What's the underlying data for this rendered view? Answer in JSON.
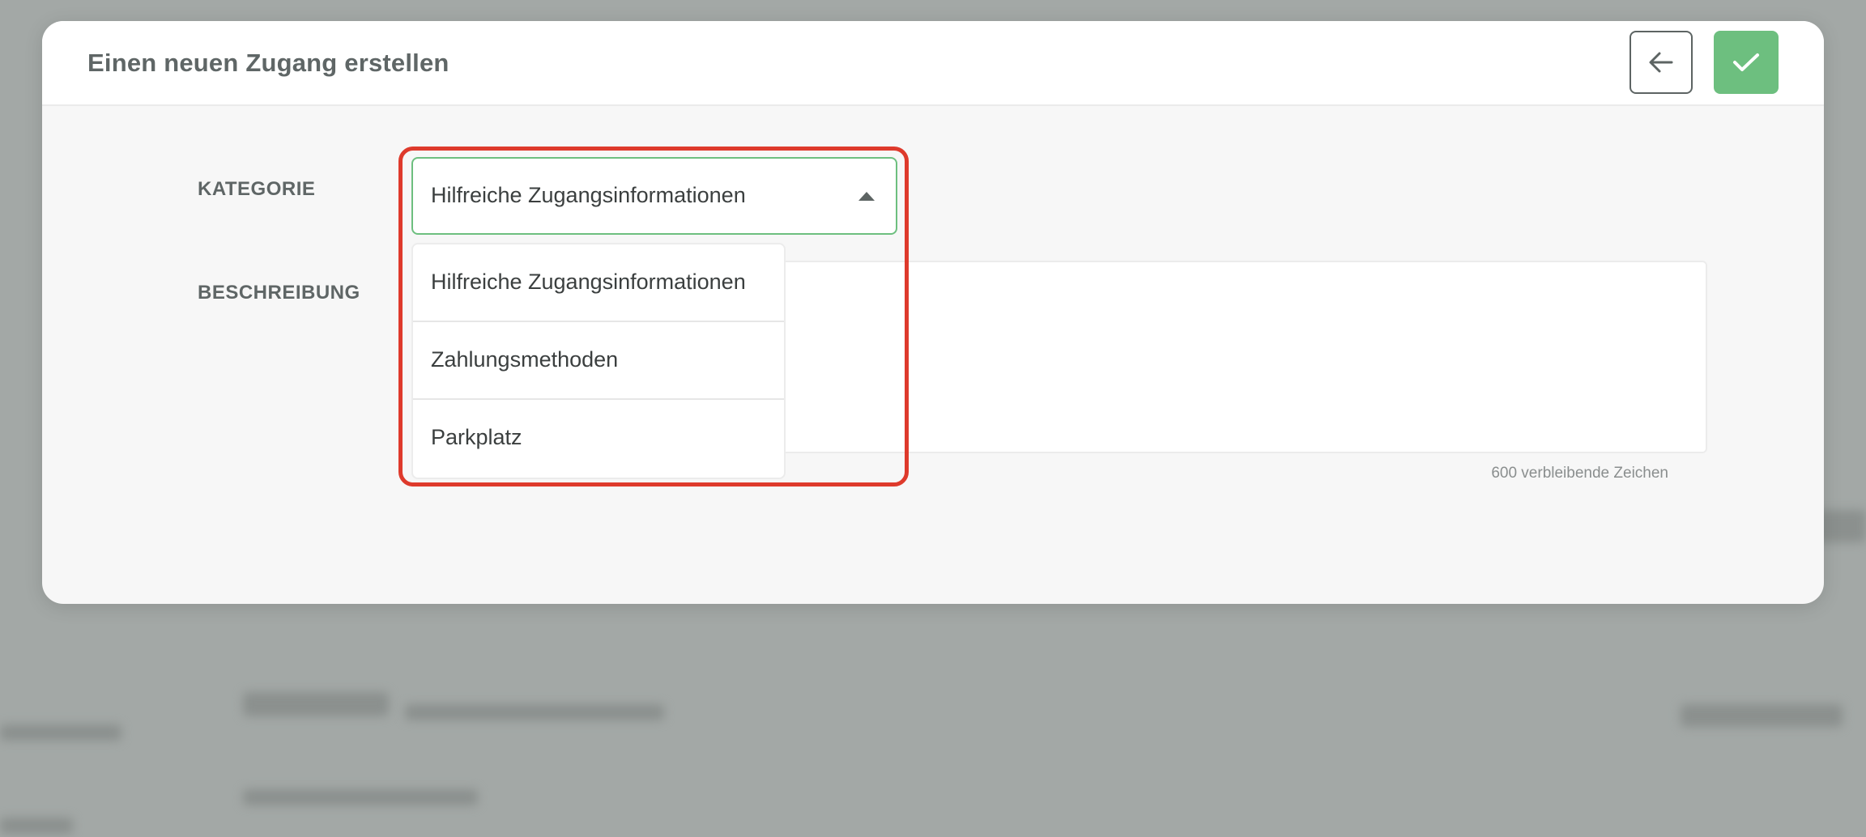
{
  "modal": {
    "title": "Einen neuen Zugang erstellen",
    "back_icon": "arrow-left-icon",
    "confirm_icon": "check-icon",
    "accent_color": "#6dbf7f",
    "highlight_color": "#de3a2c"
  },
  "form": {
    "category_label": "KATEGORIE",
    "description_label": "BESCHREIBUNG",
    "category_selected": "Hilfreiche Zugangsinformationen",
    "category_options": [
      "Hilfreiche Zugangsinformationen",
      "Zahlungsmethoden",
      "Parkplatz"
    ],
    "char_counter": "600 verbleibende Zeichen"
  }
}
